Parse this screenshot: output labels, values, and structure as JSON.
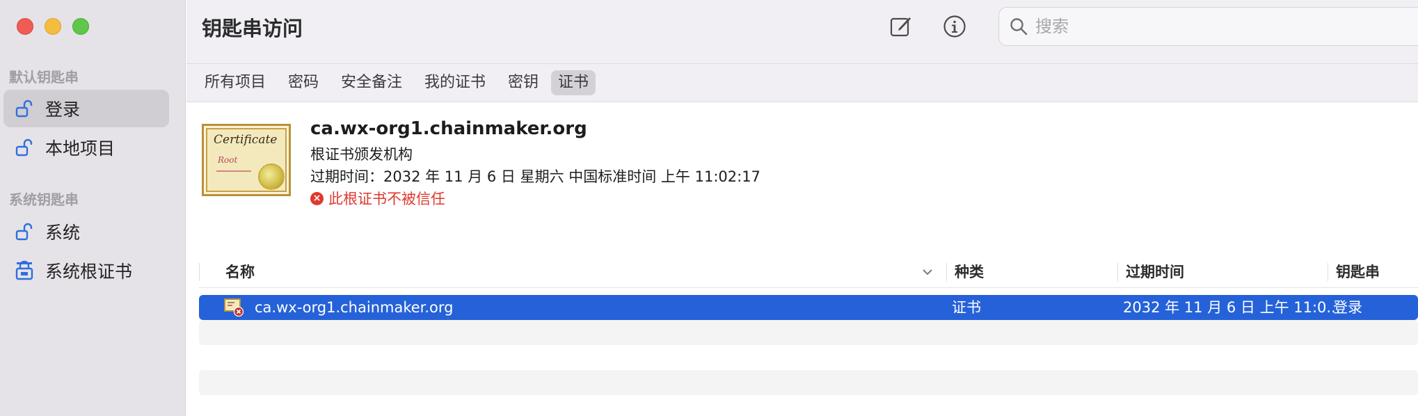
{
  "app": {
    "title": "钥匙串访问"
  },
  "sidebar": {
    "sections": [
      {
        "label": "默认钥匙串",
        "items": [
          {
            "label": "登录",
            "selected": true,
            "icon": "unlocked-icon"
          },
          {
            "label": "本地项目",
            "selected": false,
            "icon": "unlocked-icon"
          }
        ]
      },
      {
        "label": "系统钥匙串",
        "items": [
          {
            "label": "系统",
            "selected": false,
            "icon": "unlocked-icon"
          },
          {
            "label": "系统根证书",
            "selected": false,
            "icon": "locked-icon"
          }
        ]
      }
    ]
  },
  "toolbar": {
    "compose_icon": "compose-icon",
    "info_icon": "info-icon",
    "search_placeholder": "搜索"
  },
  "tabs": [
    {
      "label": "所有项目",
      "active": false
    },
    {
      "label": "密码",
      "active": false
    },
    {
      "label": "安全备注",
      "active": false
    },
    {
      "label": "我的证书",
      "active": false
    },
    {
      "label": "密钥",
      "active": false
    },
    {
      "label": "证书",
      "active": true
    }
  ],
  "detail": {
    "icon": "certificate-icon",
    "icon_title": "Certificate",
    "icon_subtitle": "Root",
    "name": "ca.wx-org1.chainmaker.org",
    "kind": "根证书颁发机构",
    "expires": "过期时间：2032 年 11 月 6 日 星期六 中国标准时间 上午 11:02:17",
    "warning": "此根证书不被信任"
  },
  "table": {
    "columns": [
      "名称",
      "种类",
      "过期时间",
      "钥匙串"
    ],
    "rows": [
      {
        "name": "ca.wx-org1.chainmaker.org",
        "kind": "证书",
        "expires": "2032 年 11 月 6 日 上午 11:0...",
        "keychain": "登录",
        "selected": true
      }
    ]
  },
  "colors": {
    "accent": "#2562d9",
    "warning": "#e0382e",
    "sidebar_bg": "#e6e3e8",
    "toolbar_bg": "#f1eff3"
  }
}
